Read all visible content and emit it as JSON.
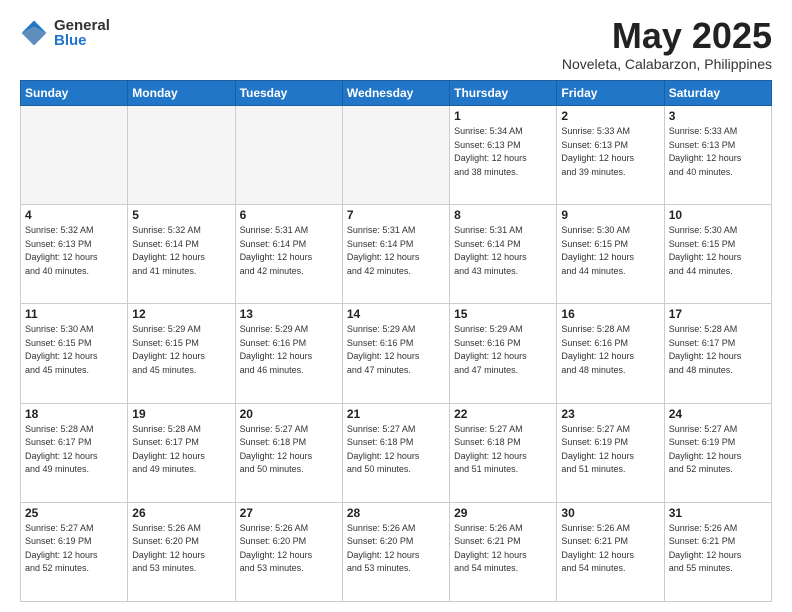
{
  "logo": {
    "general": "General",
    "blue": "Blue"
  },
  "header": {
    "month": "May 2025",
    "location": "Noveleta, Calabarzon, Philippines"
  },
  "days_of_week": [
    "Sunday",
    "Monday",
    "Tuesday",
    "Wednesday",
    "Thursday",
    "Friday",
    "Saturday"
  ],
  "weeks": [
    [
      {
        "day": "",
        "info": ""
      },
      {
        "day": "",
        "info": ""
      },
      {
        "day": "",
        "info": ""
      },
      {
        "day": "",
        "info": ""
      },
      {
        "day": "1",
        "info": "Sunrise: 5:34 AM\nSunset: 6:13 PM\nDaylight: 12 hours\nand 38 minutes."
      },
      {
        "day": "2",
        "info": "Sunrise: 5:33 AM\nSunset: 6:13 PM\nDaylight: 12 hours\nand 39 minutes."
      },
      {
        "day": "3",
        "info": "Sunrise: 5:33 AM\nSunset: 6:13 PM\nDaylight: 12 hours\nand 40 minutes."
      }
    ],
    [
      {
        "day": "4",
        "info": "Sunrise: 5:32 AM\nSunset: 6:13 PM\nDaylight: 12 hours\nand 40 minutes."
      },
      {
        "day": "5",
        "info": "Sunrise: 5:32 AM\nSunset: 6:14 PM\nDaylight: 12 hours\nand 41 minutes."
      },
      {
        "day": "6",
        "info": "Sunrise: 5:31 AM\nSunset: 6:14 PM\nDaylight: 12 hours\nand 42 minutes."
      },
      {
        "day": "7",
        "info": "Sunrise: 5:31 AM\nSunset: 6:14 PM\nDaylight: 12 hours\nand 42 minutes."
      },
      {
        "day": "8",
        "info": "Sunrise: 5:31 AM\nSunset: 6:14 PM\nDaylight: 12 hours\nand 43 minutes."
      },
      {
        "day": "9",
        "info": "Sunrise: 5:30 AM\nSunset: 6:15 PM\nDaylight: 12 hours\nand 44 minutes."
      },
      {
        "day": "10",
        "info": "Sunrise: 5:30 AM\nSunset: 6:15 PM\nDaylight: 12 hours\nand 44 minutes."
      }
    ],
    [
      {
        "day": "11",
        "info": "Sunrise: 5:30 AM\nSunset: 6:15 PM\nDaylight: 12 hours\nand 45 minutes."
      },
      {
        "day": "12",
        "info": "Sunrise: 5:29 AM\nSunset: 6:15 PM\nDaylight: 12 hours\nand 45 minutes."
      },
      {
        "day": "13",
        "info": "Sunrise: 5:29 AM\nSunset: 6:16 PM\nDaylight: 12 hours\nand 46 minutes."
      },
      {
        "day": "14",
        "info": "Sunrise: 5:29 AM\nSunset: 6:16 PM\nDaylight: 12 hours\nand 47 minutes."
      },
      {
        "day": "15",
        "info": "Sunrise: 5:29 AM\nSunset: 6:16 PM\nDaylight: 12 hours\nand 47 minutes."
      },
      {
        "day": "16",
        "info": "Sunrise: 5:28 AM\nSunset: 6:16 PM\nDaylight: 12 hours\nand 48 minutes."
      },
      {
        "day": "17",
        "info": "Sunrise: 5:28 AM\nSunset: 6:17 PM\nDaylight: 12 hours\nand 48 minutes."
      }
    ],
    [
      {
        "day": "18",
        "info": "Sunrise: 5:28 AM\nSunset: 6:17 PM\nDaylight: 12 hours\nand 49 minutes."
      },
      {
        "day": "19",
        "info": "Sunrise: 5:28 AM\nSunset: 6:17 PM\nDaylight: 12 hours\nand 49 minutes."
      },
      {
        "day": "20",
        "info": "Sunrise: 5:27 AM\nSunset: 6:18 PM\nDaylight: 12 hours\nand 50 minutes."
      },
      {
        "day": "21",
        "info": "Sunrise: 5:27 AM\nSunset: 6:18 PM\nDaylight: 12 hours\nand 50 minutes."
      },
      {
        "day": "22",
        "info": "Sunrise: 5:27 AM\nSunset: 6:18 PM\nDaylight: 12 hours\nand 51 minutes."
      },
      {
        "day": "23",
        "info": "Sunrise: 5:27 AM\nSunset: 6:19 PM\nDaylight: 12 hours\nand 51 minutes."
      },
      {
        "day": "24",
        "info": "Sunrise: 5:27 AM\nSunset: 6:19 PM\nDaylight: 12 hours\nand 52 minutes."
      }
    ],
    [
      {
        "day": "25",
        "info": "Sunrise: 5:27 AM\nSunset: 6:19 PM\nDaylight: 12 hours\nand 52 minutes."
      },
      {
        "day": "26",
        "info": "Sunrise: 5:26 AM\nSunset: 6:20 PM\nDaylight: 12 hours\nand 53 minutes."
      },
      {
        "day": "27",
        "info": "Sunrise: 5:26 AM\nSunset: 6:20 PM\nDaylight: 12 hours\nand 53 minutes."
      },
      {
        "day": "28",
        "info": "Sunrise: 5:26 AM\nSunset: 6:20 PM\nDaylight: 12 hours\nand 53 minutes."
      },
      {
        "day": "29",
        "info": "Sunrise: 5:26 AM\nSunset: 6:21 PM\nDaylight: 12 hours\nand 54 minutes."
      },
      {
        "day": "30",
        "info": "Sunrise: 5:26 AM\nSunset: 6:21 PM\nDaylight: 12 hours\nand 54 minutes."
      },
      {
        "day": "31",
        "info": "Sunrise: 5:26 AM\nSunset: 6:21 PM\nDaylight: 12 hours\nand 55 minutes."
      }
    ]
  ]
}
